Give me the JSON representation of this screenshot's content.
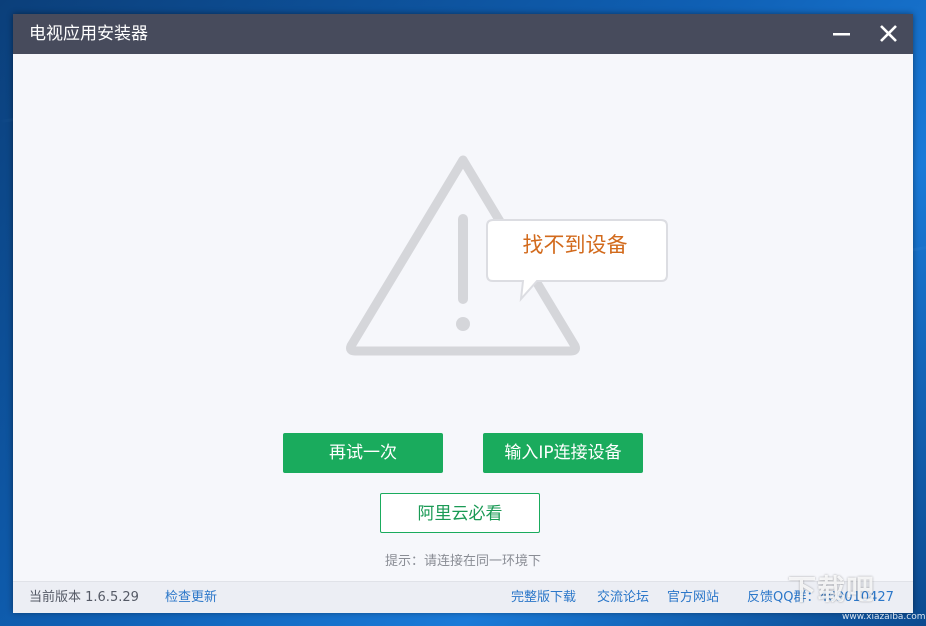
{
  "window": {
    "title": "电视应用安装器"
  },
  "icons": {
    "minimize": "minimize-icon",
    "close": "close-icon",
    "warning": "warning-triangle-icon"
  },
  "main": {
    "status_message": "找不到设备",
    "retry_label": "再试一次",
    "ip_connect_label": "输入IP连接设备",
    "aliyun_label": "阿里云必看",
    "hint": "提示：请连接在同一环境下"
  },
  "statusbar": {
    "version": "当前版本 1.6.5.29",
    "check_update": "检查更新",
    "full_download": "完整版下载",
    "forum": "交流论坛",
    "official_site": "官方网站",
    "qq_group": "反馈QQ群：469010427"
  },
  "colors": {
    "titlebar": "#474b5c",
    "accent_green": "#1aab5d",
    "status_orange": "#d26a1c",
    "link_blue": "#2b77c9"
  },
  "watermark": {
    "text": "下载吧",
    "sub": "www.xiazaiba.com"
  }
}
